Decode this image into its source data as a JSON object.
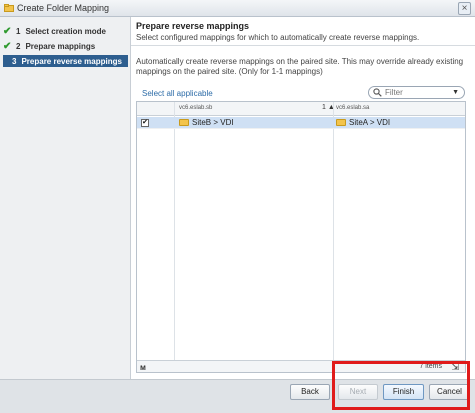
{
  "window": {
    "title": "Create Folder Mapping"
  },
  "sidebar": {
    "steps": [
      {
        "num": "1",
        "label": "Select creation mode",
        "status": "done"
      },
      {
        "num": "2",
        "label": "Prepare mappings",
        "status": "done"
      },
      {
        "num": "3",
        "label": "Prepare reverse mappings",
        "status": "active"
      }
    ]
  },
  "header": {
    "title": "Prepare reverse mappings",
    "description": "Select configured mappings for which to automatically create reverse mappings."
  },
  "info": "Automatically create reverse mappings on the paired site. This may override already existing mappings on the paired site. (Only for 1-1 mappings)",
  "toolbar": {
    "select_all": "Select all applicable",
    "filter_placeholder": "Filter"
  },
  "grid": {
    "columns": [
      "vc6.eslab.sb",
      "vc6.eslab.sa"
    ],
    "sort_indicator": "1 ▲",
    "rows": [
      {
        "checked": "✔",
        "source": "SiteB > VDI",
        "target": "SiteA > VDI"
      }
    ],
    "footer_items": "7 items"
  },
  "buttons": {
    "back": "Back",
    "next": "Next",
    "finish": "Finish",
    "cancel": "Cancel"
  },
  "colors": {
    "accent": "#2d5e8f",
    "selected_row": "#cfe0f4",
    "highlight": "#e01b1b"
  }
}
